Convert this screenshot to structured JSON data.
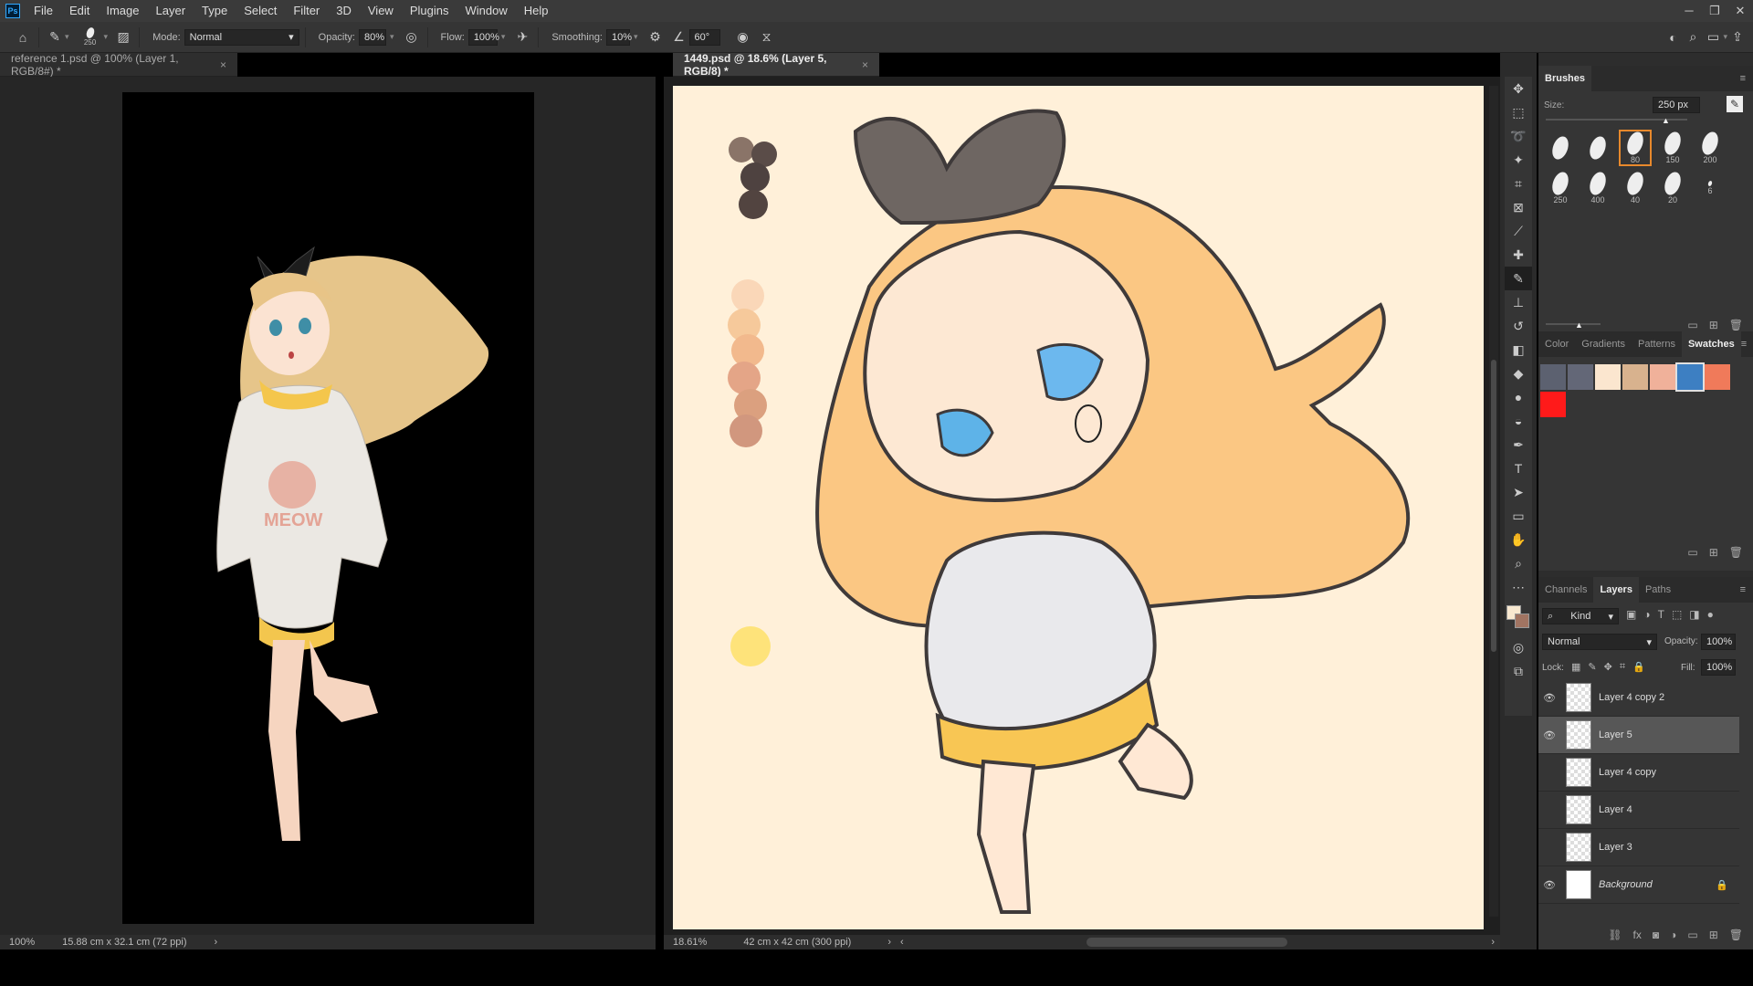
{
  "menu": {
    "items": [
      "File",
      "Edit",
      "Image",
      "Layer",
      "Type",
      "Select",
      "Filter",
      "3D",
      "View",
      "Plugins",
      "Window",
      "Help"
    ]
  },
  "options": {
    "brush_size": "250",
    "mode_label": "Mode:",
    "mode_value": "Normal",
    "opacity_label": "Opacity:",
    "opacity_value": "80%",
    "flow_label": "Flow:",
    "flow_value": "100%",
    "smoothing_label": "Smoothing:",
    "smoothing_value": "10%",
    "angle_value": "60°"
  },
  "tabs": {
    "left": "reference 1.psd @ 100% (Layer 1, RGB/8#) *",
    "right": "1449.psd @ 18.6% (Layer 5, RGB/8) *"
  },
  "status": {
    "left_zoom": "100%",
    "left_size": "15.88 cm x 32.1 cm (72 ppi)",
    "right_zoom": "18.61%",
    "right_size": "42 cm x 42 cm (300 ppi)"
  },
  "brushes": {
    "title": "Brushes",
    "size_label": "Size:",
    "size_value": "250 px",
    "presets": [
      "",
      "",
      "80",
      "150",
      "200",
      "250",
      "400",
      "40",
      "20",
      "6"
    ]
  },
  "color_panel": {
    "tabs": [
      "Color",
      "Gradients",
      "Patterns",
      "Swatches"
    ],
    "active": "Swatches",
    "swatches": [
      "#5c6170",
      "#636777",
      "#fbe6cf",
      "#d8b28e",
      "#f0b19a",
      "#3d7fc2",
      "#f07a5a",
      "#ff1a1a"
    ]
  },
  "layers_panel": {
    "tabs": [
      "Channels",
      "Layers",
      "Paths"
    ],
    "active": "Layers",
    "filter": "Kind",
    "blend": "Normal",
    "opacity_label": "Opacity:",
    "opacity": "100%",
    "lock_label": "Lock:",
    "fill_label": "Fill:",
    "fill": "100%",
    "layers": [
      {
        "name": "Layer 4 copy 2",
        "visible": true,
        "selected": false
      },
      {
        "name": "Layer 5",
        "visible": true,
        "selected": true
      },
      {
        "name": "Layer 4 copy",
        "visible": false,
        "selected": false
      },
      {
        "name": "Layer 4",
        "visible": false,
        "selected": false
      },
      {
        "name": "Layer 3",
        "visible": false,
        "selected": false
      },
      {
        "name": "Background",
        "visible": true,
        "selected": false
      }
    ]
  },
  "icons": {
    "home": "home-icon",
    "brush": "brush-icon",
    "eye": "eye-icon",
    "lock": "lock-icon"
  }
}
